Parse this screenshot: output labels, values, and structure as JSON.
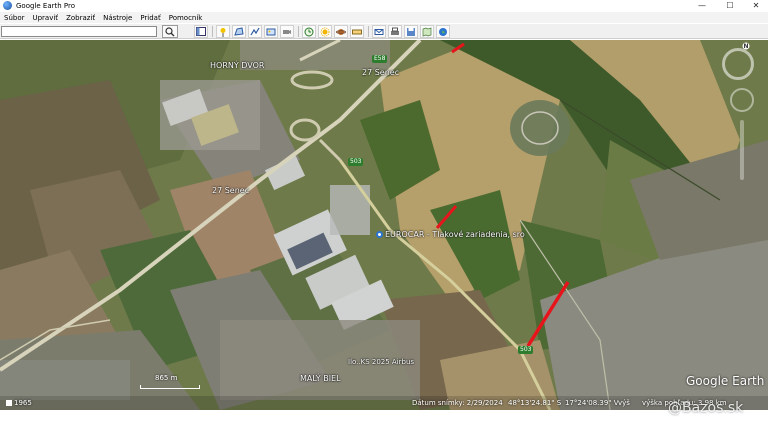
{
  "window": {
    "title": "Google Earth Pro",
    "controls": [
      "—",
      "☐",
      "✕"
    ]
  },
  "menu": [
    "Súbor",
    "Upraviť",
    "Zobraziť",
    "Nástroje",
    "Pridať",
    "Pomocník"
  ],
  "search": {
    "value": "",
    "placeholder": ""
  },
  "map": {
    "labels": {
      "town_north": "HORNÝ DVOR",
      "town_south": "MALÝ BIEL",
      "road_27_north": "27 Senec",
      "road_27_west": "27 Senec",
      "company": "EUROCAR - Tlakové zariadenia, sro",
      "shield_e58": "E58",
      "shield_503_north": "503",
      "shield_503_south": "503",
      "misc": "Ilo..KS 2025 Airbus"
    },
    "scale": "865 m",
    "logo": "Google Earth",
    "status": {
      "left": "1965",
      "date": "Dátum snímky: 2/29/2024",
      "lat": "48°13'24.81\" S",
      "lon": "17°24'08.39\" V",
      "elev": "výš",
      "view": "výška pohľadu: 3.98 km"
    },
    "accent_color": "#e8141b"
  },
  "watermark": "Bazos.sk"
}
